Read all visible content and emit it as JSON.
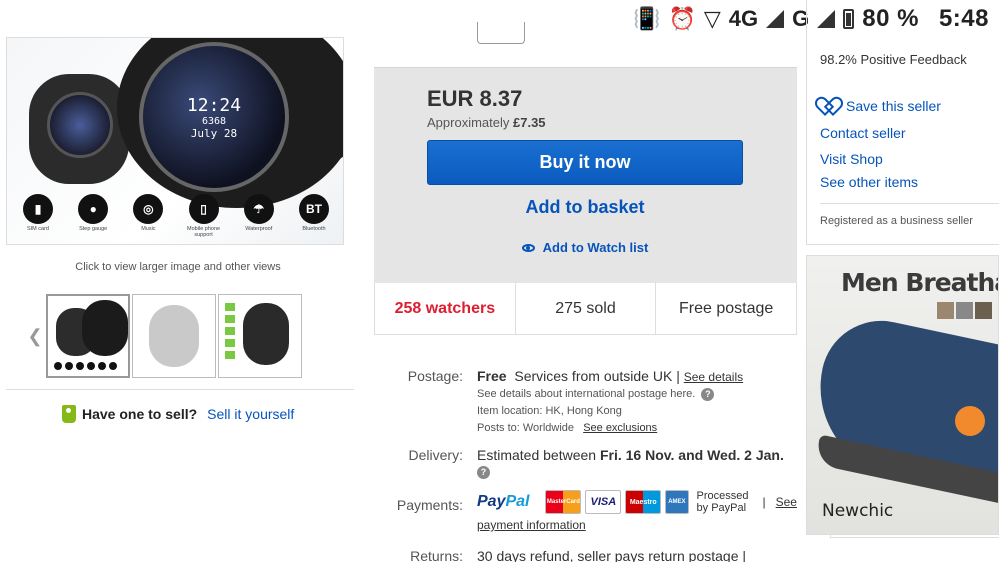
{
  "status_bar": {
    "network": "4G",
    "network2": "G",
    "battery": "80 %",
    "time": "5:48"
  },
  "gallery": {
    "caption": "Click to view larger image and other views",
    "features": [
      "SIM card",
      "Step gauge",
      "Music",
      "Mobile phone support",
      "Waterproof",
      "Bluetooth"
    ],
    "watch_time": "12:24",
    "watch_date": "July 28",
    "watch_steps": "6368"
  },
  "sell": {
    "question": "Have one to sell?",
    "link": "Sell it yourself"
  },
  "buy_box": {
    "price": "EUR 8.37",
    "approx_label": "Approximately",
    "approx_value": "£7.35",
    "buy_now": "Buy it now",
    "add_basket": "Add to basket",
    "watch_list": "Add to Watch list"
  },
  "stats": {
    "watchers": "258 watchers",
    "sold": "275 sold",
    "postage": "Free postage"
  },
  "details": {
    "postage_label": "Postage:",
    "postage_free": "Free",
    "postage_service": "Services from outside UK |",
    "postage_see_details": "See details",
    "postage_intl": "See details about international postage here.",
    "item_location": "Item location:  HK, Hong Kong",
    "posts_to": "Posts to:  Worldwide",
    "see_exclusions": "See exclusions",
    "delivery_label": "Delivery:",
    "delivery_text": "Estimated between",
    "delivery_dates": "Fri. 16 Nov. and Wed. 2 Jan.",
    "payments_label": "Payments:",
    "paypal_a": "Pay",
    "paypal_b": "Pal",
    "cards": [
      "MasterCard",
      "VISA",
      "Maestro",
      "AMEX"
    ],
    "processed_1": "Processed",
    "processed_2": "by PayPal",
    "see": "See",
    "payment_info": "payment information",
    "returns_label": "Returns:",
    "returns_text": "30 days refund, seller pays return postage |"
  },
  "seller": {
    "feedback": "98.2% Positive Feedback",
    "save": "Save this seller",
    "contact": "Contact seller",
    "visit": "Visit Shop",
    "other": "See other items",
    "registered": "Registered as a business seller"
  },
  "ad": {
    "title": "Men Breathable",
    "brand": "Newchic"
  },
  "colors": {
    "link": "#0654ba",
    "buy_button": "#0b5bbf",
    "watchers_red": "#dd1e31"
  }
}
